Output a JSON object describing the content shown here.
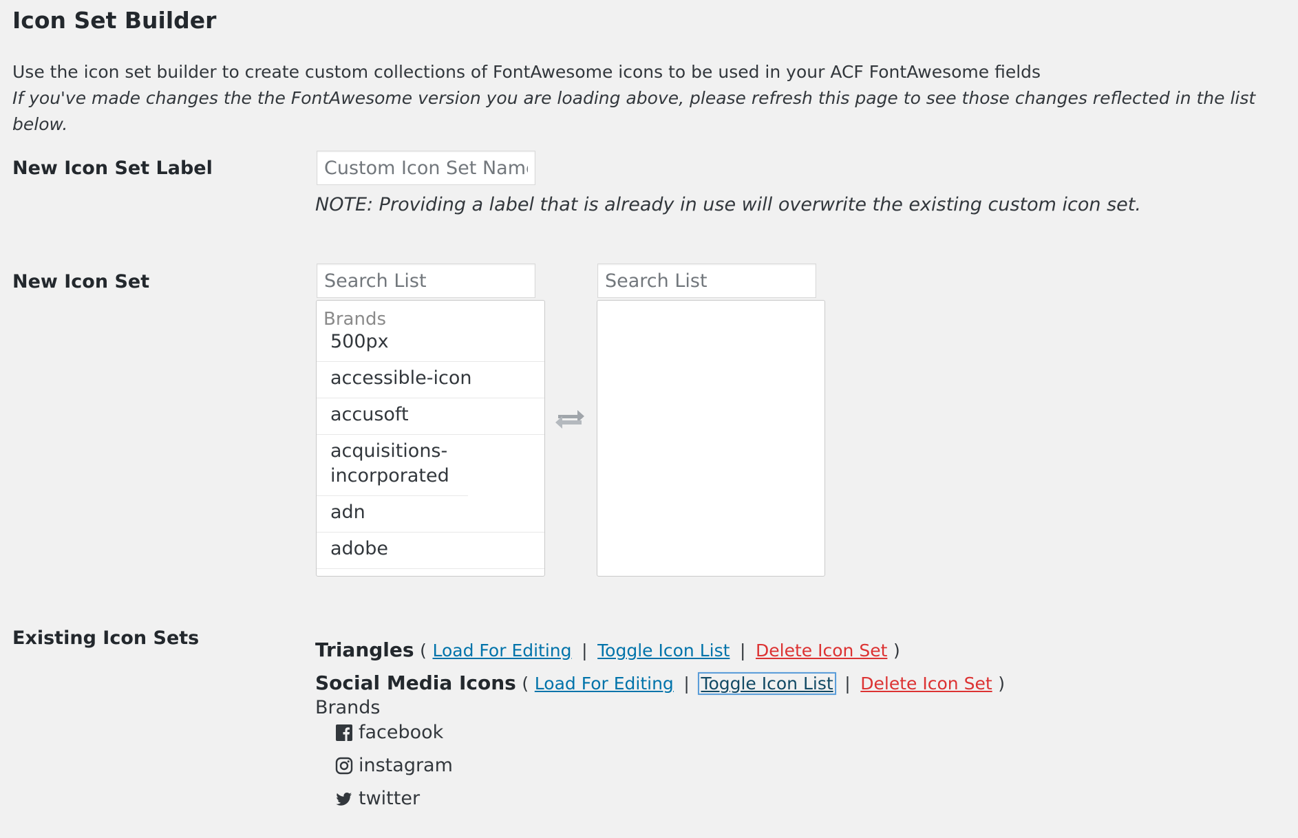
{
  "header": {
    "title": "Icon Set Builder",
    "description": "Use the icon set builder to create custom collections of FontAwesome icons to be used in your ACF FontAwesome fields",
    "refresh_note": "If you've made changes the the FontAwesome version you are loading above, please refresh this page to see those changes reflected in the list below."
  },
  "label_row": {
    "label": "New Icon Set Label",
    "input_value": "",
    "input_placeholder": "Custom Icon Set Name",
    "note": "NOTE: Providing a label that is already in use will overwrite the existing custom icon set."
  },
  "icon_set_row": {
    "label": "New Icon Set",
    "left_search_placeholder": "Search List",
    "right_search_placeholder": "Search List",
    "left_group": "Brands",
    "left_items": [
      "500px",
      "accessible-icon",
      "accusoft",
      "acquisitions-incorporated",
      "adn",
      "adobe"
    ],
    "swap_icon": "exchange-arrows-icon"
  },
  "existing_sets": {
    "label": "Existing Icon Sets",
    "open_paren": "(",
    "close_paren": ")",
    "separator": "|",
    "sets": [
      {
        "name": "Triangles",
        "load_label": "Load For Editing",
        "toggle_label": "Toggle Icon List",
        "delete_label": "Delete Icon Set"
      },
      {
        "name": "Social Media Icons",
        "load_label": "Load For Editing",
        "toggle_label": "Toggle Icon List",
        "delete_label": "Delete Icon Set"
      }
    ],
    "expanded_group": "Brands",
    "expanded_icons": [
      {
        "icon": "facebook-icon",
        "label": "facebook"
      },
      {
        "icon": "instagram-icon",
        "label": "instagram"
      },
      {
        "icon": "twitter-icon",
        "label": "twitter"
      }
    ]
  },
  "colors": {
    "link": "#0073aa",
    "delete_link": "#dc3232",
    "background": "#f1f1f1"
  }
}
